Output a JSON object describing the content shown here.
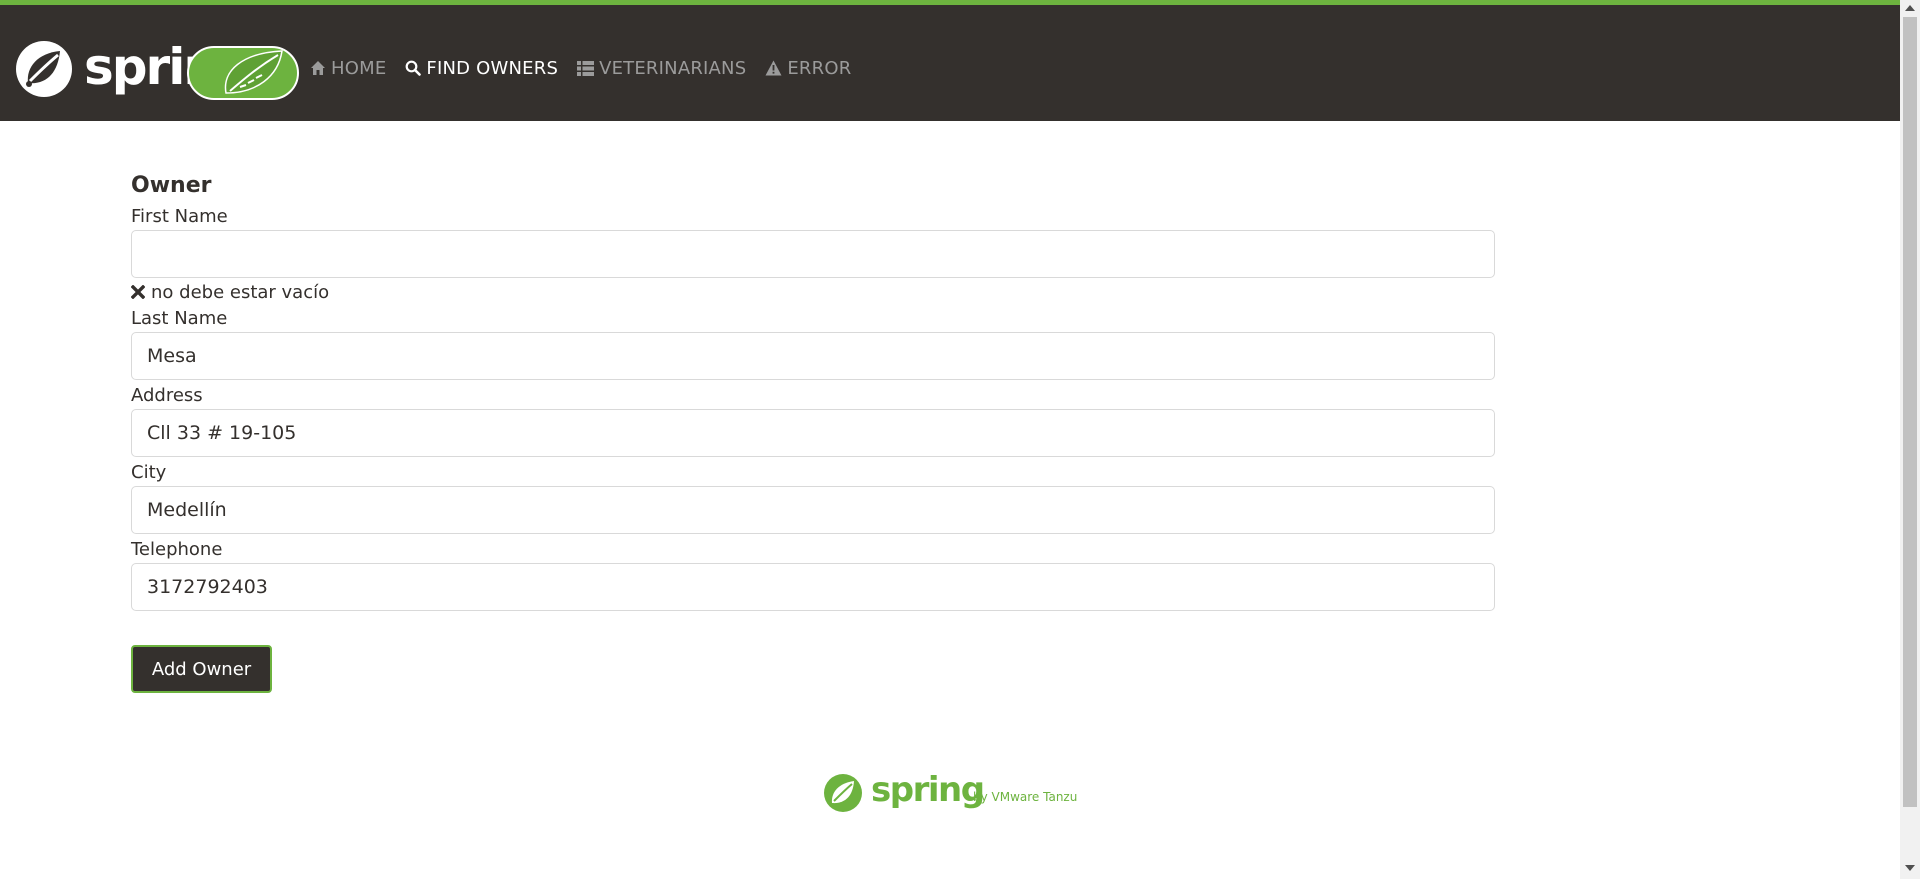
{
  "brand": {
    "name": "spring",
    "accent": "#6db33f",
    "nav_bg": "#34302d"
  },
  "nav": {
    "items": [
      {
        "label": "HOME",
        "icon": "home-icon",
        "active": false
      },
      {
        "label": "FIND OWNERS",
        "icon": "search-icon",
        "active": true
      },
      {
        "label": "VETERINARIANS",
        "icon": "list-icon",
        "active": false
      },
      {
        "label": "ERROR",
        "icon": "warning-icon",
        "active": false
      }
    ]
  },
  "form": {
    "title": "Owner",
    "first_name": {
      "label": "First Name",
      "value": "",
      "error": "no debe estar vacío"
    },
    "last_name": {
      "label": "Last Name",
      "value": "Mesa"
    },
    "address": {
      "label": "Address",
      "value": "Cll 33 # 19-105"
    },
    "city": {
      "label": "City",
      "value": "Medellín"
    },
    "telephone": {
      "label": "Telephone",
      "value": "3172792403"
    },
    "submit_label": "Add Owner"
  },
  "footer": {
    "brand": "spring",
    "tagline": "by VMware Tanzu"
  }
}
